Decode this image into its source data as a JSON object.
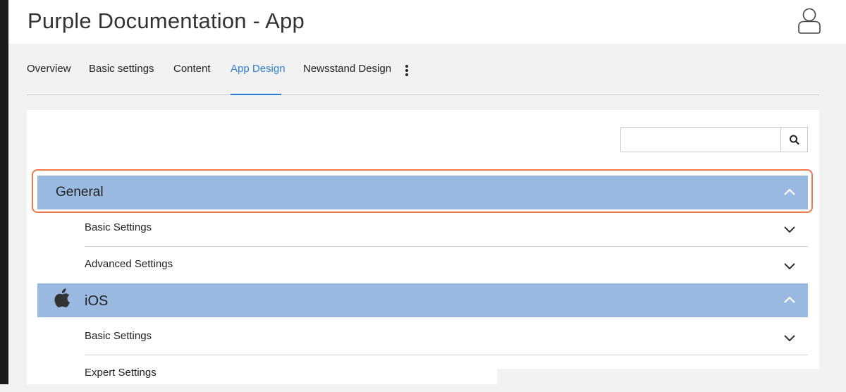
{
  "header": {
    "title": "Purple Documentation - App",
    "user_icon": "user-icon"
  },
  "tabs": [
    {
      "label": "Overview",
      "active": false
    },
    {
      "label": "Basic settings",
      "active": false
    },
    {
      "label": "Content",
      "active": false
    },
    {
      "label": "App Design",
      "active": true
    },
    {
      "label": "Newsstand Design",
      "active": false
    }
  ],
  "more_icon": "kebab-menu-icon",
  "search": {
    "value": "",
    "icon": "search-icon"
  },
  "sections": [
    {
      "title": "General",
      "icon": null,
      "expanded": true,
      "items": [
        {
          "label": "Basic Settings",
          "expanded": false
        },
        {
          "label": "Advanced Settings",
          "expanded": false
        }
      ]
    },
    {
      "title": "iOS",
      "icon": "apple-icon",
      "expanded": true,
      "items": [
        {
          "label": "Basic Settings",
          "expanded": false
        },
        {
          "label": "Expert Settings",
          "expanded": false
        }
      ]
    }
  ],
  "colors": {
    "accent": "#2f7fd1",
    "section_header_bg": "#99b9e1",
    "highlight_border": "#ef7b4d",
    "page_bg": "#f2f2f2"
  }
}
